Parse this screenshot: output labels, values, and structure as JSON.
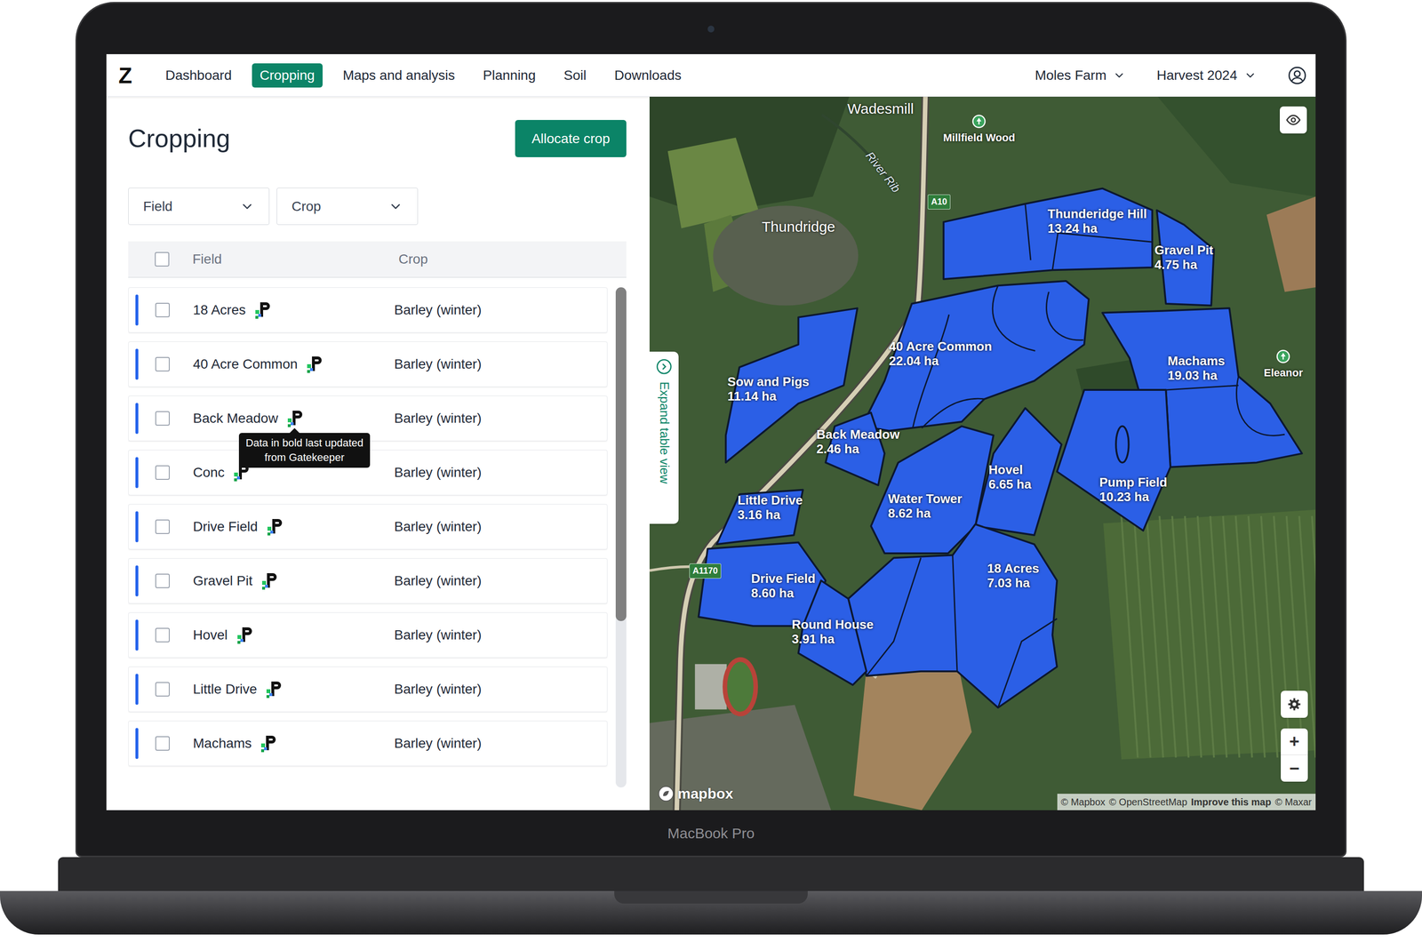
{
  "app": {
    "logo": "Z",
    "nav": [
      {
        "label": "Dashboard",
        "selected": false
      },
      {
        "label": "Cropping",
        "selected": true
      },
      {
        "label": "Maps and analysis",
        "selected": false
      },
      {
        "label": "Planning",
        "selected": false
      },
      {
        "label": "Soil",
        "selected": false
      },
      {
        "label": "Downloads",
        "selected": false
      }
    ],
    "farm": "Moles Farm",
    "season": "Harvest 2024"
  },
  "panel": {
    "title": "Cropping",
    "allocate_button": "Allocate crop",
    "filters": [
      "Field",
      "Crop"
    ],
    "table": {
      "columns": [
        "Field",
        "Crop"
      ],
      "select_all": false,
      "rows": [
        {
          "field": "18 Acres",
          "crop": "Barley (winter)",
          "checked": false
        },
        {
          "field": "40 Acre Common",
          "crop": "Barley (winter)",
          "checked": false
        },
        {
          "field": "Back Meadow",
          "crop": "Barley (winter)",
          "checked": false,
          "tooltip": [
            "Data in bold last updated",
            "from Gatekeeper"
          ]
        },
        {
          "field": "Conc",
          "crop": "Barley (winter)",
          "checked": false
        },
        {
          "field": "Drive Field",
          "crop": "Barley (winter)",
          "checked": false
        },
        {
          "field": "Gravel Pit",
          "crop": "Barley (winter)",
          "checked": false
        },
        {
          "field": "Hovel",
          "crop": "Barley (winter)",
          "checked": false
        },
        {
          "field": "Little Drive",
          "crop": "Barley (winter)",
          "checked": false
        },
        {
          "field": "Machams",
          "crop": "Barley (winter)",
          "checked": false
        }
      ]
    }
  },
  "map": {
    "expand_tab": "Expand table view",
    "fields": [
      {
        "name": "Thunderidge Hill",
        "area": "13.24 ha"
      },
      {
        "name": "Gravel Pit",
        "area": "4.75 ha"
      },
      {
        "name": "40 Acre Common",
        "area": "22.04 ha"
      },
      {
        "name": "Sow and Pigs",
        "area": "11.14 ha"
      },
      {
        "name": "Machams",
        "area": "19.03 ha"
      },
      {
        "name": "Back Meadow",
        "area": "2.46 ha"
      },
      {
        "name": "Hovel",
        "area": "6.65 ha"
      },
      {
        "name": "Pump Field",
        "area": "10.23 ha"
      },
      {
        "name": "Water Tower",
        "area": "8.62 ha"
      },
      {
        "name": "Little Drive",
        "area": "3.16 ha"
      },
      {
        "name": "Drive Field",
        "area": "8.60 ha"
      },
      {
        "name": "18 Acres",
        "area": "7.03 ha"
      },
      {
        "name": "Round House",
        "area": "3.91 ha"
      }
    ],
    "places": [
      {
        "label": "Wadesmill",
        "kind": "place"
      },
      {
        "label": "Thundridge",
        "kind": "place"
      },
      {
        "label": "Millfield Wood",
        "kind": "poi"
      },
      {
        "label": "River Rib",
        "kind": "water"
      },
      {
        "label": "A10",
        "kind": "road"
      },
      {
        "label": "A1170",
        "kind": "road"
      },
      {
        "label": "Eleanor",
        "kind": "poi"
      }
    ],
    "logo": "mapbox",
    "attribution": [
      {
        "label": "© Mapbox",
        "kind": "text"
      },
      {
        "label": "© OpenStreetMap",
        "kind": "text"
      },
      {
        "label": "Improve this map",
        "kind": "link"
      },
      {
        "label": "© Maxar",
        "kind": "text"
      }
    ],
    "zoom": [
      "+",
      "−"
    ]
  },
  "device": {
    "label": "MacBook Pro"
  }
}
